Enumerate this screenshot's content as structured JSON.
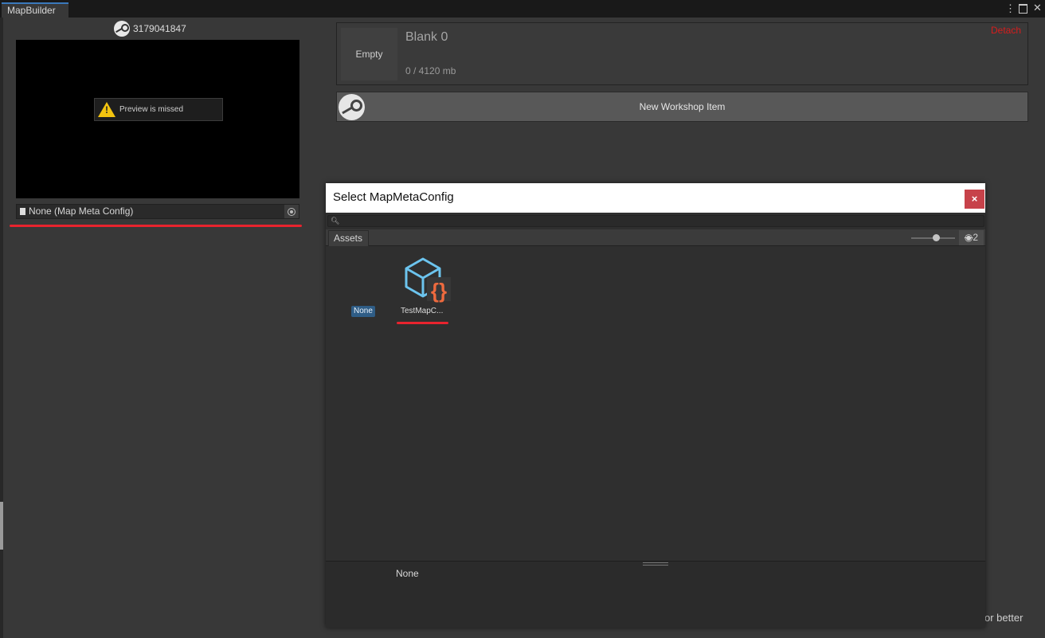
{
  "window": {
    "tab_label": "MapBuilder",
    "tab_icons": [
      "kebab-menu-icon",
      "maximize-icon",
      "close-icon"
    ],
    "hint_text": "or better"
  },
  "left_panel": {
    "steam_id": "3179041847",
    "preview_message": "Preview is missed",
    "object_field_value": "None (Map Meta Config)"
  },
  "right_panel": {
    "card": {
      "thumbnail_label": "Empty",
      "title": "Blank 0",
      "size": "0 / 4120 mb",
      "detach_label": "Detach"
    },
    "new_item_label": "New Workshop Item"
  },
  "dialog": {
    "title": "Select MapMetaConfig",
    "close_label": "×",
    "search_placeholder": "",
    "tab_label": "Assets",
    "hidden_count": "2",
    "items": [
      {
        "label": "None",
        "type": "none"
      },
      {
        "label": "TestMapC...",
        "type": "script-asset"
      }
    ],
    "footer_selection": "None"
  },
  "colors": {
    "highlight_red": "#e8232e",
    "detach_red": "#d71d1d",
    "asset_blue": "#6cc4ee",
    "asset_orange": "#ee6a3e",
    "none_badge": "#2f5d86",
    "close_button": "#c7424a"
  }
}
